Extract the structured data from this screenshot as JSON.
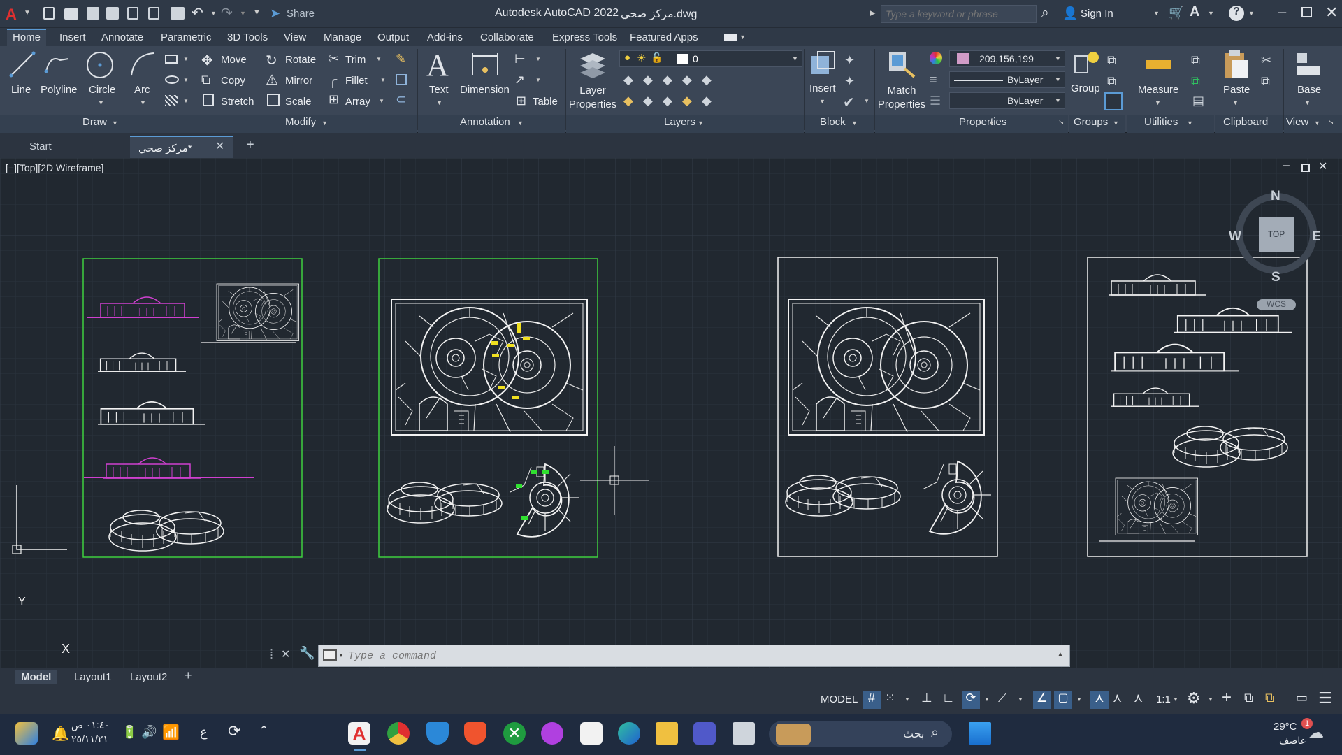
{
  "title_bar": {
    "app_title": "Autodesk AutoCAD 2022",
    "file_title": "مركز صحي.dwg",
    "share_label": "Share",
    "search_placeholder": "Type a keyword or phrase",
    "sign_in": "Sign In"
  },
  "ribbon_tabs": [
    "Home",
    "Insert",
    "Annotate",
    "Parametric",
    "3D Tools",
    "View",
    "Manage",
    "Output",
    "Add-ins",
    "Collaborate",
    "Express Tools",
    "Featured Apps"
  ],
  "ribbon": {
    "draw": {
      "title": "Draw",
      "line": "Line",
      "polyline": "Polyline",
      "circle": "Circle",
      "arc": "Arc"
    },
    "modify": {
      "title": "Modify",
      "move": "Move",
      "rotate": "Rotate",
      "trim": "Trim",
      "copy": "Copy",
      "mirror": "Mirror",
      "fillet": "Fillet",
      "stretch": "Stretch",
      "scale": "Scale",
      "array": "Array"
    },
    "annotation": {
      "title": "Annotation",
      "text": "Text",
      "dimension": "Dimension",
      "table": "Table"
    },
    "layers": {
      "title": "Layers",
      "layer_properties": "Layer Properties",
      "current_layer": "0"
    },
    "block": {
      "title": "Block",
      "insert": "Insert"
    },
    "properties": {
      "title": "Properties",
      "match_properties": "Match Properties",
      "color_value": "209,156,199",
      "linetype": "ByLayer",
      "lineweight": "ByLayer"
    },
    "groups": {
      "title": "Groups",
      "group": "Group"
    },
    "utilities": {
      "title": "Utilities",
      "measure": "Measure"
    },
    "clipboard": {
      "title": "Clipboard",
      "paste": "Paste"
    },
    "view": {
      "title": "View",
      "base": "Base"
    }
  },
  "file_tabs": {
    "start": "Start",
    "drawing": "مركز صحي*"
  },
  "viewport": {
    "label": "[−][Top][2D Wireframe]",
    "compass": {
      "n": "N",
      "s": "S",
      "e": "E",
      "w": "W",
      "top": "TOP",
      "wcs": "WCS"
    },
    "ucs_x": "X",
    "ucs_y": "Y"
  },
  "command": {
    "placeholder": "Type a command"
  },
  "layout_tabs": [
    "Model",
    "Layout1",
    "Layout2"
  ],
  "status": {
    "model": "MODEL",
    "scale": "1:1"
  },
  "taskbar": {
    "time": "٠١:٤٠ ص",
    "date": "٢٥/١١/٢١",
    "lang": "ع",
    "search": "بحث",
    "weather_temp": "29°C",
    "weather_desc": "عاصف",
    "notif_count": "1"
  },
  "colors": {
    "accent": "#5b9bd5",
    "sheet_border_green": "#3fcf3f",
    "magenta": "#d040d0",
    "yellow": "#f0e020"
  }
}
